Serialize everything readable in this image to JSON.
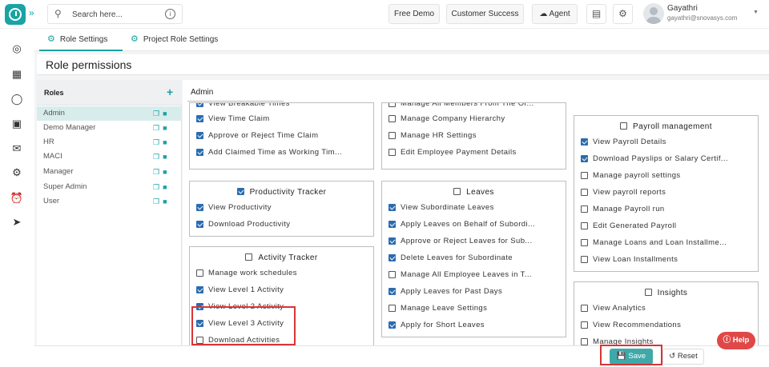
{
  "header": {
    "search_placeholder": "Search here...",
    "free_demo": "Free Demo",
    "customer_success": "Customer Success",
    "agent": "Agent",
    "user_name": "Gayathri",
    "user_email": "gayathri@snovasys.com"
  },
  "tabs": [
    {
      "label": "Role Settings",
      "active": true
    },
    {
      "label": "Project Role Settings",
      "active": false
    }
  ],
  "page_title": "Role permissions",
  "roles_panel": {
    "title": "Roles",
    "items": [
      "Admin",
      "Demo Manager",
      "HR",
      "MACI",
      "Manager",
      "Super Admin",
      "User"
    ],
    "selected": "Admin"
  },
  "selected_role": "Admin",
  "cards": {
    "col1_top": {
      "items": [
        {
          "label": "View Breakable Times",
          "checked": true
        },
        {
          "label": "View Time Claim",
          "checked": true
        },
        {
          "label": "Approve or Reject Time Claim",
          "checked": true
        },
        {
          "label": "Add Claimed Time as Working Tim...",
          "checked": true
        }
      ]
    },
    "productivity": {
      "title": "Productivity Tracker",
      "title_checked": true,
      "items": [
        {
          "label": "View Productivity",
          "checked": true
        },
        {
          "label": "Download Productivity",
          "checked": true
        }
      ]
    },
    "activity": {
      "title": "Activity Tracker",
      "title_checked": false,
      "items": [
        {
          "label": "Manage work schedules",
          "checked": false
        },
        {
          "label": "View Level 1 Activity",
          "checked": true
        },
        {
          "label": "View Level 2 Activity",
          "checked": true
        },
        {
          "label": "View Level 3 Activity",
          "checked": true
        },
        {
          "label": "Download Activities",
          "checked": false
        }
      ]
    },
    "col2_top": {
      "items": [
        {
          "label": "Manage All Members From The Or...",
          "checked": false
        },
        {
          "label": "Manage Company Hierarchy",
          "checked": false
        },
        {
          "label": "Manage HR Settings",
          "checked": false
        },
        {
          "label": "Edit Employee Payment Details",
          "checked": false
        }
      ]
    },
    "leaves": {
      "title": "Leaves",
      "title_checked": false,
      "items": [
        {
          "label": "View Subordinate Leaves",
          "checked": true
        },
        {
          "label": "Apply Leaves on Behalf of Subordi...",
          "checked": true
        },
        {
          "label": "Approve or Reject Leaves for Sub...",
          "checked": true
        },
        {
          "label": "Delete Leaves for Subordinate",
          "checked": true
        },
        {
          "label": "Manage All Employee Leaves in T...",
          "checked": false
        },
        {
          "label": "Apply Leaves for Past Days",
          "checked": true
        },
        {
          "label": "Manage Leave Settings",
          "checked": false
        },
        {
          "label": "Apply for Short Leaves",
          "checked": true
        }
      ]
    },
    "payroll": {
      "title": "Payroll management",
      "title_checked": false,
      "items": [
        {
          "label": "View Payroll Details",
          "checked": true
        },
        {
          "label": "Download Payslips or Salary Certif...",
          "checked": true
        },
        {
          "label": "Manage payroll settings",
          "checked": false
        },
        {
          "label": "View payroll reports",
          "checked": false
        },
        {
          "label": "Manage Payroll run",
          "checked": false
        },
        {
          "label": "Edit Generated Payroll",
          "checked": false
        },
        {
          "label": "Manage Loans and Loan Installme...",
          "checked": false
        },
        {
          "label": "View Loan Installments",
          "checked": false
        }
      ]
    },
    "insights": {
      "title": "Insights",
      "title_checked": false,
      "items": [
        {
          "label": "View Analytics",
          "checked": false
        },
        {
          "label": "View Recommendations",
          "checked": false
        },
        {
          "label": "Manage Insights",
          "checked": false
        }
      ]
    }
  },
  "footer": {
    "save_label": "Save",
    "reset_label": "Reset"
  },
  "help_label": "Help",
  "colors": {
    "accent": "#1aa3a3",
    "checkbox": "#2b6cb0",
    "highlight": "#d93434",
    "help": "#e04848"
  }
}
